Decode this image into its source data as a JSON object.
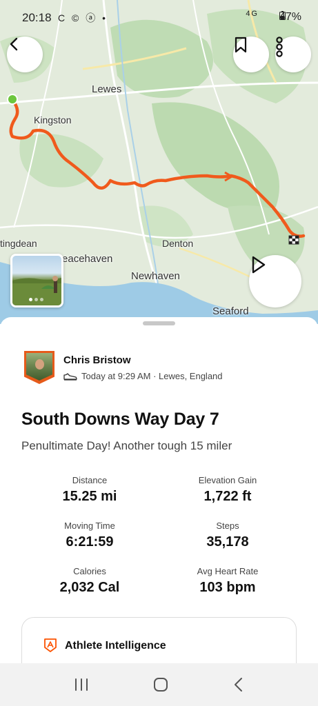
{
  "status": {
    "time": "20:18",
    "left_icons": "C © ⓐ •",
    "network": "4G",
    "battery": "47%"
  },
  "map": {
    "places": [
      "Lewes",
      "Kingston",
      "tingdean",
      "Denton",
      "Peacehaven",
      "Newhaven",
      "Seaford"
    ],
    "route_color": "#f05a1c",
    "start_color": "#6cc63d"
  },
  "buttons": {
    "back_icon": "chevron-left-icon",
    "bookmark_icon": "bookmark-icon",
    "more_icon": "more-vertical-icon",
    "play_icon": "play-icon"
  },
  "athlete": {
    "name": "Chris Bristow",
    "meta": "Today at 9:29 AM · Lewes, England",
    "activity_icon": "shoe-icon"
  },
  "activity": {
    "title": "South Downs Way Day 7",
    "description": "Penultimate Day! Another tough 15 miler"
  },
  "stats": [
    {
      "label": "Distance",
      "value": "15.25 mi"
    },
    {
      "label": "Elevation Gain",
      "value": "1,722 ft"
    },
    {
      "label": "Moving Time",
      "value": "6:21:59"
    },
    {
      "label": "Steps",
      "value": "35,178"
    },
    {
      "label": "Calories",
      "value": "2,032 Cal"
    },
    {
      "label": "Avg Heart Rate",
      "value": "103 bpm"
    }
  ],
  "athlete_intelligence": {
    "title": "Athlete Intelligence"
  },
  "colors": {
    "accent": "#fc5200",
    "sea": "#9ecbe6",
    "land": "#dfe9d7"
  }
}
